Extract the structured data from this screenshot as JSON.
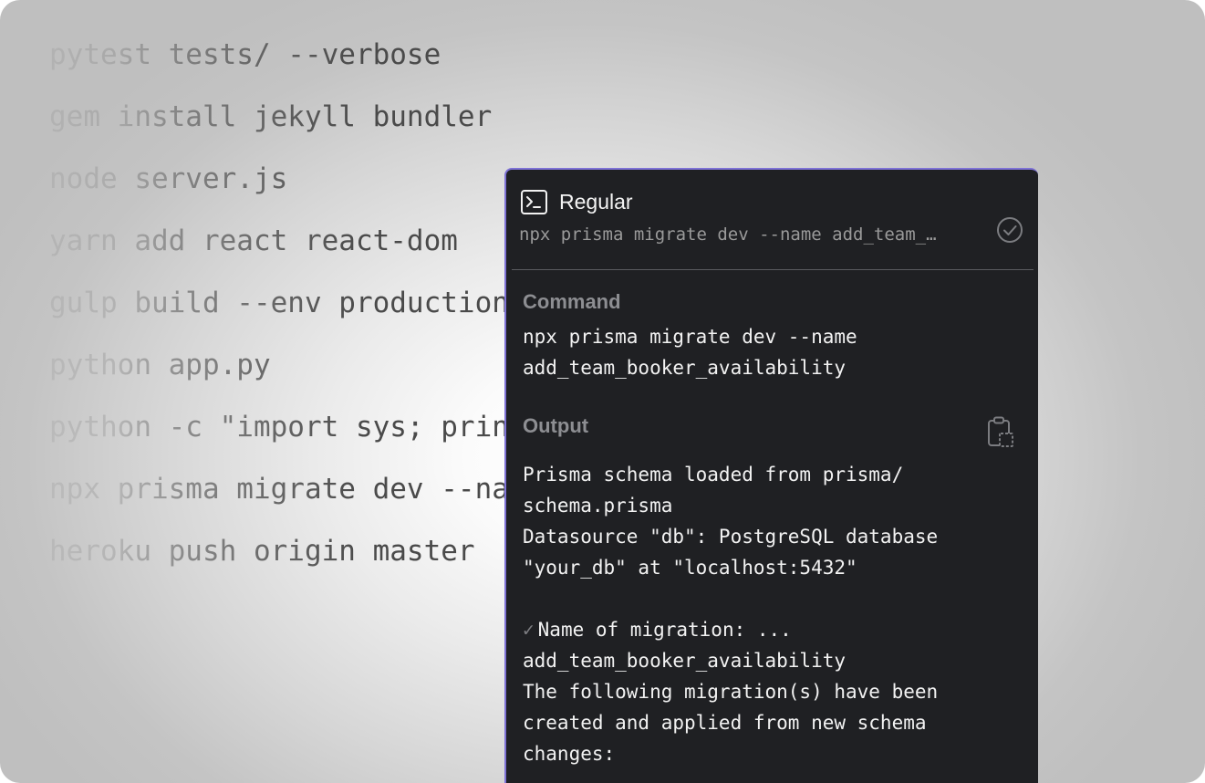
{
  "history": [
    "pytest tests/ --verbose",
    "gem install jekyll bundler",
    "node server.js",
    "yarn add react react-dom",
    "gulp build --env production",
    "python app.py",
    "python -c \"import sys; print(sys.version)\"",
    "npx prisma migrate dev --name add_team_booker_availability",
    "heroku push origin master"
  ],
  "panel": {
    "mode_label": "Regular",
    "header_command": "npx prisma migrate dev --name add_team_…",
    "command_title": "Command",
    "command_lines": [
      "npx prisma migrate dev --name",
      "add_team_booker_availability"
    ],
    "output_title": "Output",
    "output_lines": [
      "Prisma schema loaded from prisma/",
      "schema.prisma",
      "Datasource \"db\": PostgreSQL database",
      "\"your_db\" at \"localhost:5432\"",
      "",
      "Name of migration: ...",
      "add_team_booker_availability",
      "The following migration(s) have been",
      "created and applied from new schema",
      "changes:"
    ],
    "check_mark": "✓",
    "icons": {
      "terminal": "terminal-icon",
      "status": "check-circle-icon",
      "copy": "copy-clipboard-icon"
    },
    "accent_color": "#7e72d6",
    "background_color": "#1f2023"
  }
}
